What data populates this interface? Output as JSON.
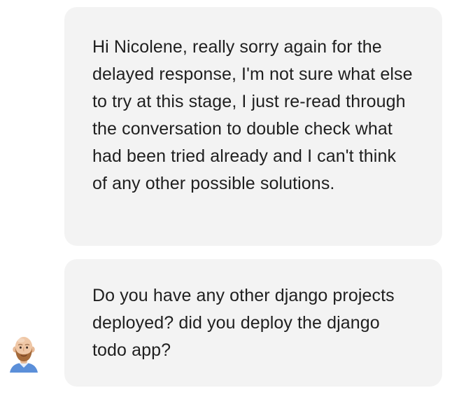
{
  "conversation": {
    "messages": [
      {
        "text": "Hi Nicolene, really sorry again for the delayed response, I'm not sure what else to try at this stage, I just re-read through the conversation to double check what had been tried already and I can't think of any other possible solutions."
      },
      {
        "text": "Do you have any other django projects deployed? did you deploy the django todo app?"
      }
    ],
    "avatar_icon": "bald-man-with-beard-avatar",
    "colors": {
      "bubble_background": "#f3f3f3",
      "text": "#1f1f1f",
      "avatar_shirt": "#5b8fd9",
      "avatar_skin": "#efc7a6",
      "avatar_beard": "#a56a3a"
    }
  }
}
